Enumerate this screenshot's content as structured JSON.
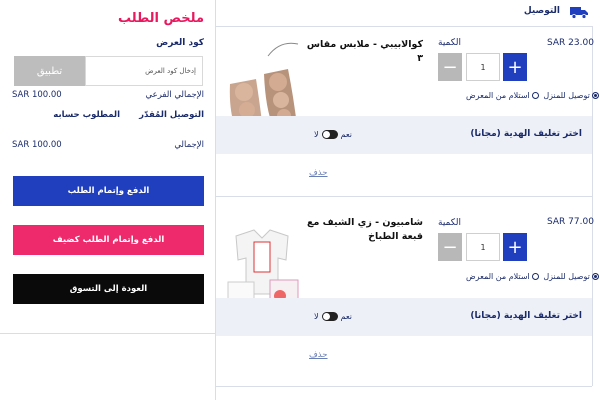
{
  "header": {
    "delivery_label": "التوصيل",
    "truck_icon": "delivery-truck-icon"
  },
  "summary": {
    "title": "ملخص الطلب",
    "promo_label": "كود العرض",
    "promo_placeholder": "إدخال كود العرض",
    "apply_label": "تطبيق",
    "rows": [
      {
        "label": "الإجمالي الفرعي",
        "value": "SAR 100.00"
      },
      {
        "label": "التوصيل المُقدّر",
        "value": "المطلوب حسابه"
      },
      {
        "label": "الإجمالي",
        "value": "SAR 100.00"
      }
    ],
    "pay_button": "الدفع وإتمام الطلب",
    "pay_later_button": "الدفع وإتمام الطلب كضيف",
    "back_button": "العودة إلى التسوق"
  },
  "items": [
    {
      "title": "كوالابيبي - ملابس مقاس ٣",
      "price": "SAR 23.00",
      "qty_label": "الكمية",
      "qty": "1",
      "option_home": "توصيل للمنزل",
      "option_store": "استلام من المعرض",
      "gift_label": "اختر تغليف الهدية (مجانا)",
      "toggle_no": "لا",
      "toggle_yes": "نعم",
      "delete_label": "حذف"
    },
    {
      "title": "شامبيون - زي الشيف مع قبعة الطباخ",
      "price": "SAR 77.00",
      "qty_label": "الكمية",
      "qty": "1",
      "option_home": "توصيل للمنزل",
      "option_store": "استلام من المعرض",
      "gift_label": "اختر تغليف الهدية (مجانا)",
      "toggle_no": "لا",
      "toggle_yes": "نعم",
      "delete_label": "حذف"
    }
  ],
  "colors": {
    "brand_blue": "#1f3fbf",
    "accent_pink": "#ee2a6d",
    "text_navy": "#1a2b6b",
    "gift_bar_bg": "#eef0f7"
  }
}
